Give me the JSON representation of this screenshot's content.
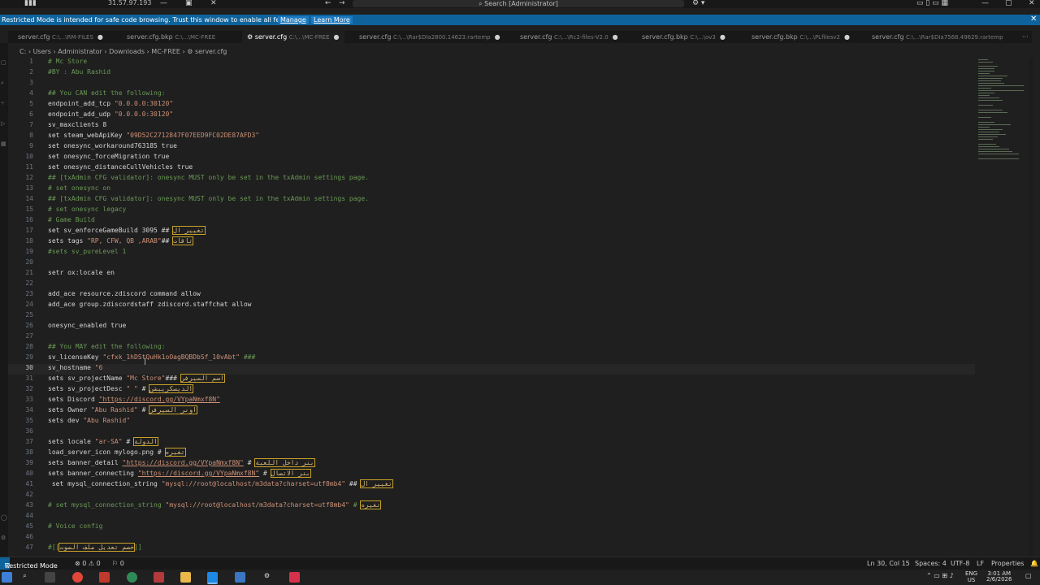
{
  "titlebar": {
    "ip": "31.57.97.193",
    "command_center": "Search [Administrator]"
  },
  "banner": {
    "message": "Restricted Mode is intended for safe code browsing. Trust this window to enable all features.",
    "manage": "Manage",
    "learn_more": "Learn More"
  },
  "tabs": [
    {
      "name": "server.cfg",
      "path": "C:\\...\\RM-FILES"
    },
    {
      "name": "server.cfg.bkp",
      "path": "C:\\...\\MC-FREE"
    },
    {
      "name": "server.cfg",
      "path": "C:\\...\\MC-FREE"
    },
    {
      "name": "server.cfg",
      "path": "C:\\...\\Rar$DIa2800.14623.rartemp"
    },
    {
      "name": "server.cfg",
      "path": "C:\\...\\Rc2-files-V2.0"
    },
    {
      "name": "server.cfg.bkp",
      "path": "C:\\...\\ov3"
    },
    {
      "name": "server.cfg.bkp",
      "path": "C:\\...\\PLfilesv2"
    },
    {
      "name": "server.cfg",
      "path": "C:\\...\\Rar$DIa7568.49629.rartemp"
    }
  ],
  "breadcrumb": "C: › Users › Administrator › Downloads › MC-FREE › ⚙ server.cfg",
  "statusbar": {
    "mode": "Restricted Mode",
    "problems": "⊗ 0 ⚠ 0",
    "ports": "⚐ 0",
    "position": "Ln 30, Col 15",
    "spaces": "Spaces: 4",
    "encoding": "UTF-8",
    "eol": "LF",
    "language": "Properties"
  },
  "taskbar": {
    "lang": "ENG",
    "region": "US",
    "time": "3:01 AM",
    "date": "2/6/2026"
  },
  "code": {
    "l1": "# Mc Store",
    "l2": "#BY : Abu Rashid",
    "l4": "## You CAN edit the following:",
    "l5a": "endpoint_add_tcp ",
    "l5b": "\"0.0.0.0:30120\"",
    "l6a": "endpoint_add_udp ",
    "l6b": "\"0.0.0.0:30120\"",
    "l7": "sv_maxclients 8",
    "l8a": "set steam_webApiKey ",
    "l8b": "\"09D52C2712847F07EED9FC02DE87AFD3\"",
    "l9": "set onesync_workaround763185 true",
    "l10": "set onesync_forceMigration true",
    "l11": "set onesync_distanceCullVehicles true",
    "l12": "## [txAdmin CFG validator]: onesync MUST only be set in the txAdmin settings page.",
    "l13": "# set onesync on",
    "l14": "## [txAdmin CFG validator]: onesync MUST only be set in the txAdmin settings page.",
    "l15": "# set onesync legacy",
    "l16": "# Game Build",
    "l17a": "set sv_enforceGameBuild 3095 ## ",
    "l17b": "تغيير ال",
    "l18a": "sets tags ",
    "l18b": "\"RP, CFW, QB ,ARAB\"",
    "l18c": "## ",
    "l18d": "تاقات",
    "l19": "#sets sv_pureLevel 1",
    "l21": "setr ox:locale en",
    "l23": "add_ace resource.zdiscord command allow",
    "l24": "add_ace group.zdiscordstaff zdiscord.staffchat allow",
    "l26": "onesync_enabled true",
    "l28": "## You MAY edit the following:",
    "l29a": "sv_licenseKey ",
    "l29b": "\"cfxk_1hDStQuHk1oOagBQBDbSf_10vAbt\"",
    "l29c": " ###",
    "l30a": "sv_hostname ",
    "l30b": "\"6",
    "l31a": "sets sv_projectName ",
    "l31b": "\"Mc Store\"",
    "l31c": "### ",
    "l31d": "اسم السيرفر",
    "l32a": "sets sv_projectDesc ",
    "l32b": "\" \"",
    "l32c": " # ",
    "l32d": "الديسكريبشن",
    "l33a": "sets Discord ",
    "l33b": "\"https://discord.gg/VYpaNmxf8N\"",
    "l34a": "sets Owner ",
    "l34b": "\"Abu Rashid\"",
    "l34c": " # ",
    "l34d": "اونر السيرفر",
    "l35a": "sets dev ",
    "l35b": "\"Abu Rashid\"",
    "l37a": "sets locale ",
    "l37b": "\"ar-SA\"",
    "l37c": " # ",
    "l37d": "الدولة",
    "l38a": "load_server_icon mylogo.png # ",
    "l38b": "تغيره",
    "l39a": "sets banner_detail ",
    "l39b": "\"https://discord.gg/VYpaNmxf8N\"",
    "l39c": " # ",
    "l39d": "بنر داخل اللعبة",
    "l40a": "sets banner_connecting ",
    "l40b": "\"https://discord.gg/VYpaNmxf8N\"",
    "l40c": " # ",
    "l40d": "بنر الاتصال",
    "l41a": " set mysql_connection_string ",
    "l41b": "\"mysql://root@localhost/m3data?charset=utf8mb4\"",
    "l41c": " ## ",
    "l41d": "تغيير ال",
    "l43a": "# set mysql_connection_string ",
    "l43b": "\"mysql://root@localhost/m3data?charset=utf8mb4\"",
    "l43c": " # ",
    "l43d": "تغيره",
    "l45": "# Voice config",
    "l47a": "#[[",
    "l47b": "خصم تعديل ملف الصوت",
    "l47c": "]]"
  }
}
